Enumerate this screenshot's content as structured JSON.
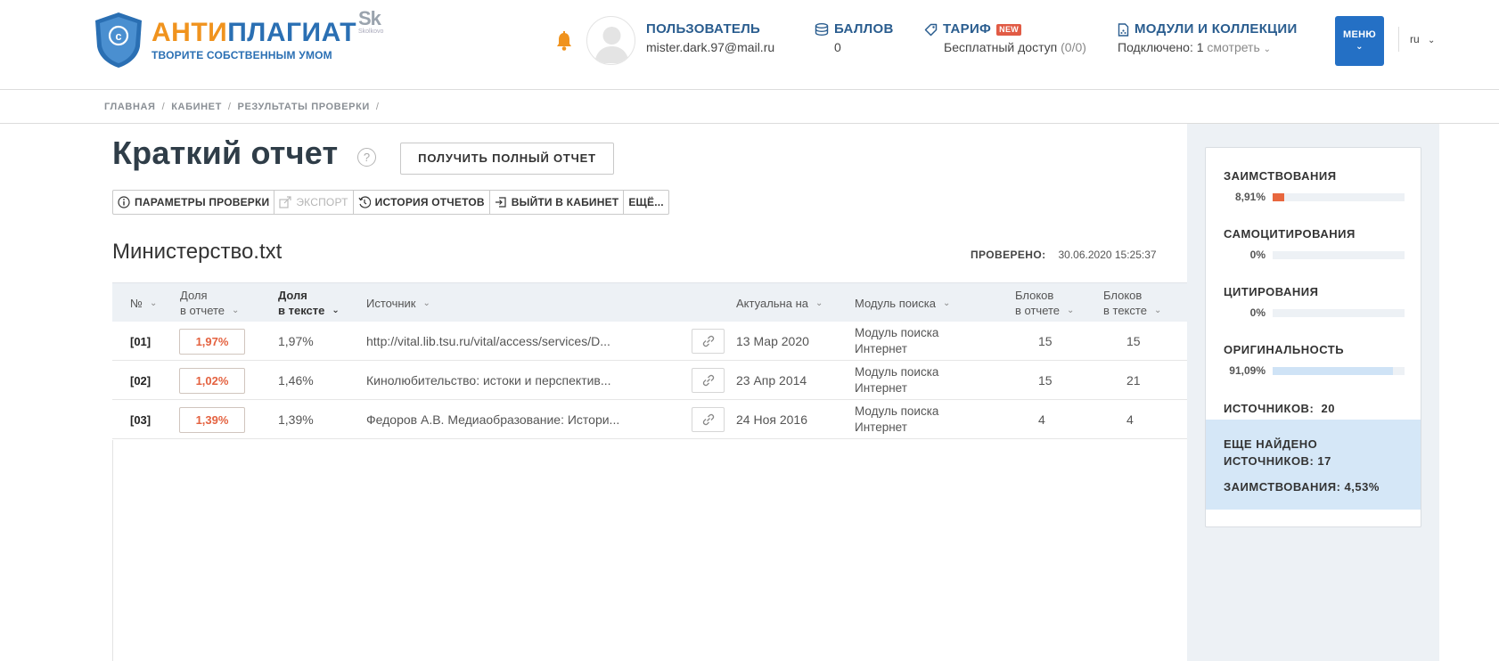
{
  "brand": {
    "name_part1": "АНТИ",
    "name_part2": "ПЛАГИАТ",
    "tagline": "ТВОРИТЕ СОБСТВЕННЫМ УМОМ",
    "partner": "Sk",
    "partner_sub": "Skolkovo",
    "colors": {
      "orange": "#f0931e",
      "blue": "#2a6fb3"
    }
  },
  "header": {
    "user_label": "ПОЛЬЗОВАТЕЛЬ",
    "user_email": "mister.dark.97@mail.ru",
    "points_label": "БАЛЛОВ",
    "points_value": "0",
    "tariff_label": "ТАРИФ",
    "tariff_badge": "NEW",
    "tariff_value": "Бесплатный доступ",
    "tariff_count": "(0/0)",
    "modules_label": "МОДУЛИ И КОЛЛЕКЦИИ",
    "modules_connected": "Подключено: 1",
    "modules_link": "смотреть",
    "menu_label": "МЕНЮ",
    "lang": "ru"
  },
  "breadcrumb": [
    "ГЛАВНАЯ",
    "КАБИНЕТ",
    "РЕЗУЛЬТАТЫ ПРОВЕРКИ"
  ],
  "report": {
    "title": "Краткий отчет",
    "help": "?",
    "full_report_button": "ПОЛУЧИТЬ ПОЛНЫЙ ОТЧЕТ",
    "toolbar": {
      "params": "ПАРАМЕТРЫ ПРОВЕРКИ",
      "export": "ЭКСПОРТ",
      "history": "ИСТОРИЯ ОТЧЕТОВ",
      "exit": "ВЫЙТИ В КАБИНЕТ",
      "more": "ЕЩЁ..."
    },
    "document_name": "Министерство.txt",
    "checked_label": "ПРОВЕРЕНО:",
    "checked_value": "30.06.2020 15:25:37"
  },
  "table": {
    "headers": {
      "num": "№",
      "share_report": "Доля\nв отчете",
      "share_report_l1": "Доля",
      "share_report_l2": "в отчете",
      "share_text_l1": "Доля",
      "share_text_l2": "в тексте",
      "source": "Источник",
      "actual": "Актуальна на",
      "module": "Модуль поиска",
      "blocks_report_l1": "Блоков",
      "blocks_report_l2": "в отчете",
      "blocks_text_l1": "Блоков",
      "blocks_text_l2": "в тексте"
    },
    "rows": [
      {
        "num": "[01]",
        "share_report": "1,97%",
        "share_text": "1,97%",
        "source": "http://vital.lib.tsu.ru/vital/access/services/D...",
        "actual": "13 Мар 2020",
        "module_l1": "Модуль поиска",
        "module_l2": "Интернет",
        "blocks_report": "15",
        "blocks_text": "15"
      },
      {
        "num": "[02]",
        "share_report": "1,02%",
        "share_text": "1,46%",
        "source": "Кинолюбительство: истоки и перспектив...",
        "actual": "23 Апр 2014",
        "module_l1": "Модуль поиска",
        "module_l2": "Интернет",
        "blocks_report": "15",
        "blocks_text": "21"
      },
      {
        "num": "[03]",
        "share_report": "1,39%",
        "share_text": "1,39%",
        "source": "Федоров А.В. Медиаобразование: Истори...",
        "actual": "24 Ноя 2016",
        "module_l1": "Модуль поиска",
        "module_l2": "Интернет",
        "blocks_report": "4",
        "blocks_text": "4"
      }
    ]
  },
  "stats": {
    "borrowings_label": "ЗАИМСТВОВАНИЯ",
    "borrowings_value": "8,91%",
    "borrowings_fraction": 0.0891,
    "borrowings_color": "#e8673e",
    "selfcite_label": "САМОЦИТИРОВАНИЯ",
    "selfcite_value": "0%",
    "selfcite_fraction": 0,
    "cite_label": "ЦИТИРОВАНИЯ",
    "cite_value": "0%",
    "cite_fraction": 0,
    "original_label": "ОРИГИНАЛЬНОСТЬ",
    "original_value": "91,09%",
    "original_fraction": 0.9109,
    "original_color": "#cfe3f6",
    "sources_label": "ИСТОЧНИКОВ:",
    "sources_value": "20",
    "more_label_l1": "ЕЩЕ НАЙДЕНО",
    "more_label_l2": "ИСТОЧНИКОВ:",
    "more_sources_value": "17",
    "more_borrow_label": "ЗАИМСТВОВАНИЯ:",
    "more_borrow_value": "4,53%"
  }
}
